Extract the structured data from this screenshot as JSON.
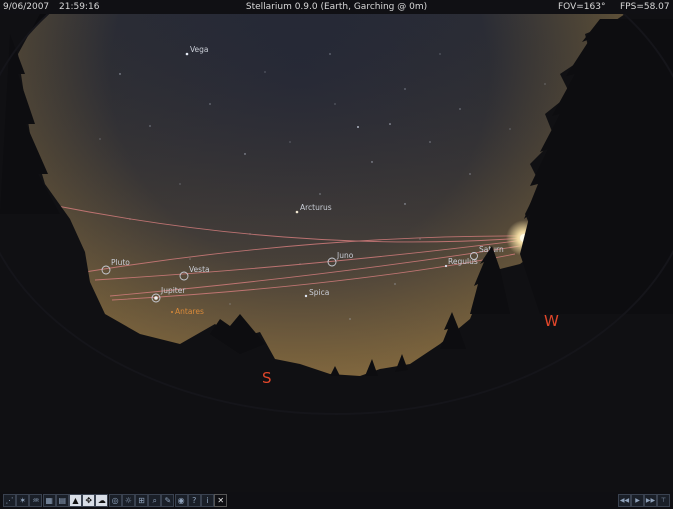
{
  "status_bar": {
    "date": "9/06/2007",
    "time": "21:59:16",
    "title": "Stellarium 0.9.0 (Earth, Garching @ 0m)",
    "fov": "FOV=163°",
    "fps": "FPS=58.07"
  },
  "sky": {
    "stars": {
      "vega": "Vega",
      "arcturus": "Arcturus",
      "spica": "Spica",
      "regulus": "Regulus",
      "antares": "Antares"
    },
    "planets": {
      "pluto": "Pluto",
      "vesta": "Vesta",
      "juno": "Juno",
      "jupiter": "Jupiter",
      "saturn": "Saturn"
    },
    "cardinals": {
      "south": "S",
      "west": "W"
    }
  },
  "toolbar": {
    "buttons": [
      {
        "icon": "constellation-lines-icon",
        "glyph": "⋰"
      },
      {
        "icon": "constellation-names-icon",
        "glyph": "✶"
      },
      {
        "icon": "constellation-art-icon",
        "glyph": "♒"
      },
      {
        "icon": "azimuth-grid-icon",
        "glyph": "▦"
      },
      {
        "icon": "equatorial-grid-icon",
        "glyph": "▤"
      },
      {
        "icon": "ground-icon",
        "glyph": "▲",
        "active": true
      },
      {
        "icon": "cardinal-points-icon",
        "glyph": "✥",
        "active": true
      },
      {
        "icon": "atmosphere-icon",
        "glyph": "☁",
        "active": true
      },
      {
        "icon": "nebulas-icon",
        "glyph": "◎"
      },
      {
        "icon": "planet-hints-icon",
        "glyph": "☼"
      },
      {
        "icon": "equatorial-mount-icon",
        "glyph": "⊞"
      },
      {
        "icon": "search-icon",
        "glyph": "⌕"
      },
      {
        "icon": "configuration-icon",
        "glyph": "✎"
      },
      {
        "icon": "night-mode-icon",
        "glyph": "◉"
      },
      {
        "icon": "help-icon",
        "glyph": "?"
      },
      {
        "icon": "info-icon",
        "glyph": "i"
      },
      {
        "icon": "quit-icon",
        "glyph": "✕",
        "close": true
      }
    ],
    "time_controls": [
      {
        "icon": "rewind-icon",
        "glyph": "◀◀"
      },
      {
        "icon": "play-icon",
        "glyph": "▶"
      },
      {
        "icon": "fast-forward-icon",
        "glyph": "▶▶"
      },
      {
        "icon": "now-icon",
        "glyph": "⊤"
      }
    ]
  },
  "colors": {
    "cardinal": "#e0462a",
    "orbit": "#d27c7c",
    "label": "#c9cdd6",
    "antares": "#d98a3a"
  }
}
